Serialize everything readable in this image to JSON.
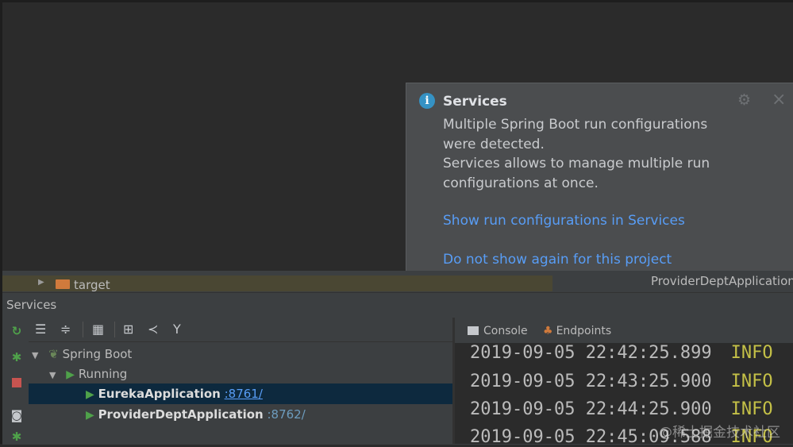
{
  "notification": {
    "title": "Services",
    "body": [
      "Multiple Spring Boot run configurations",
      "were detected.",
      "Services allows to manage multiple run",
      "configurations at once."
    ],
    "link_show": "Show run configurations in Services",
    "link_hide": "Do not show again for this project"
  },
  "project_tree": {
    "folder_label": "target",
    "right_label": "ProviderDeptApplication"
  },
  "services_panel": {
    "title": "Services",
    "tree": {
      "root": "Spring Boot",
      "group": "Running",
      "apps": [
        {
          "name": "EurekaApplication",
          "port": ":8761/"
        },
        {
          "name": "ProviderDeptApplication",
          "port": ":8762/"
        }
      ]
    }
  },
  "console_panel": {
    "tabs": [
      "Console",
      "Endpoints"
    ],
    "lines": [
      {
        "ts": "2019-09-05 22:42:25.899",
        "level": "INFO"
      },
      {
        "ts": "2019-09-05 22:43:25.900",
        "level": "INFO"
      },
      {
        "ts": "2019-09-05 22:44:25.900",
        "level": "INFO"
      },
      {
        "ts": "2019-09-05 22:45:09.588",
        "level": "INFO"
      }
    ]
  },
  "watermark": "@稀土掘金技术社区",
  "colors": {
    "link": "#589df6",
    "info_level": "#c4c047",
    "run_green": "#4fa14a",
    "selection": "#0d293e"
  }
}
